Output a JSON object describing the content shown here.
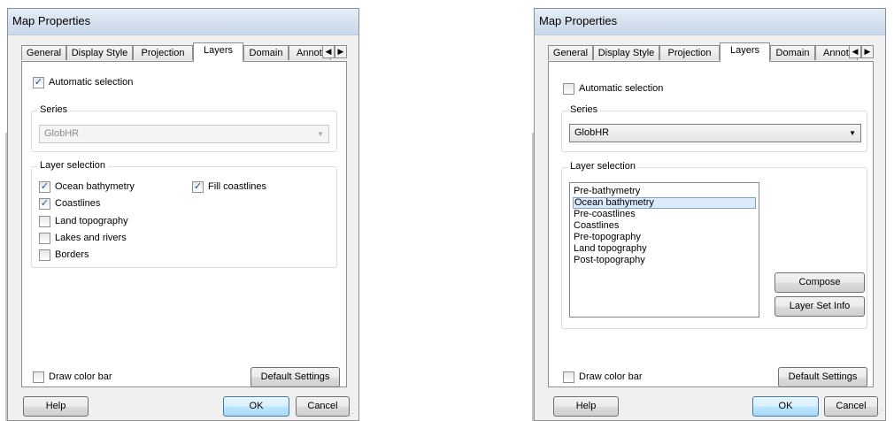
{
  "left": {
    "title": "Map Properties",
    "tabs": [
      "General",
      "Display Style",
      "Projection",
      "Layers",
      "Domain",
      "Annot"
    ],
    "active_tab": "Layers",
    "auto_selection": {
      "label": "Automatic selection",
      "checked": true
    },
    "series": {
      "label": "Series",
      "value": "GlobHR",
      "disabled": true
    },
    "layer_selection": {
      "label": "Layer selection",
      "items": [
        {
          "label": "Ocean bathymetry",
          "checked": true
        },
        {
          "label": "Coastlines",
          "checked": true
        },
        {
          "label": "Land topography",
          "checked": false
        },
        {
          "label": "Lakes and rivers",
          "checked": false
        },
        {
          "label": "Borders",
          "checked": false
        }
      ],
      "fill_coastlines": {
        "label": "Fill coastlines",
        "checked": true
      }
    },
    "draw_color_bar": {
      "label": "Draw color bar",
      "checked": false
    },
    "default_settings_label": "Default Settings",
    "help_label": "Help",
    "ok_label": "OK",
    "cancel_label": "Cancel"
  },
  "right": {
    "title": "Map Properties",
    "tabs": [
      "General",
      "Display Style",
      "Projection",
      "Layers",
      "Domain",
      "Annot"
    ],
    "active_tab": "Layers",
    "auto_selection": {
      "label": "Automatic selection",
      "checked": false
    },
    "series": {
      "label": "Series",
      "value": "GlobHR",
      "disabled": false
    },
    "layer_selection": {
      "label": "Layer selection",
      "list": [
        "Pre-bathymetry",
        "Ocean bathymetry",
        "Pre-coastlines",
        "Coastlines",
        "Pre-topography",
        "Land topography",
        "Post-topography"
      ],
      "selected": "Ocean bathymetry"
    },
    "compose_label": "Compose",
    "layer_set_info_label": "Layer Set Info",
    "draw_color_bar": {
      "label": "Draw color bar",
      "checked": false
    },
    "default_settings_label": "Default Settings",
    "help_label": "Help",
    "ok_label": "OK",
    "cancel_label": "Cancel"
  },
  "icons": {
    "tab_scroll_left": "◀",
    "tab_scroll_right": "▶",
    "dropdown": "▼",
    "check": "✓"
  }
}
